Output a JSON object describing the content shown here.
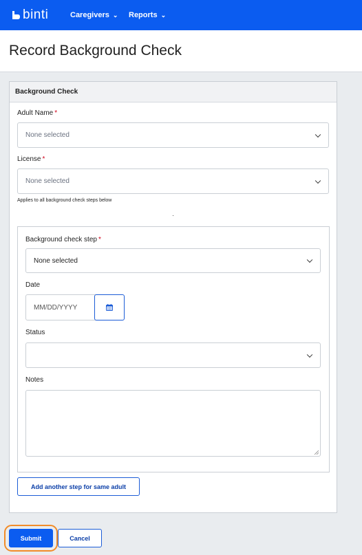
{
  "app": {
    "logo_text": "binti",
    "nav": [
      {
        "label": "Caregivers",
        "icon": "chevron-down-icon"
      },
      {
        "label": "Reports",
        "icon": "chevron-down-icon"
      }
    ]
  },
  "page": {
    "title": "Record Background Check"
  },
  "card": {
    "header": "Background Check",
    "adult_name": {
      "label": "Adult Name",
      "required": "*",
      "value": "None selected"
    },
    "license": {
      "label": "License",
      "required": "*",
      "value": "None selected",
      "helper": "Applies to all background check steps below"
    },
    "step_group": {
      "step": {
        "label": "Background check step",
        "required": "*",
        "value": "None selected"
      },
      "date": {
        "label": "Date",
        "placeholder": "MM/DD/YYYY",
        "icon": "calendar-icon"
      },
      "status": {
        "label": "Status",
        "value": ""
      },
      "notes": {
        "label": "Notes",
        "value": ""
      }
    },
    "add_step_label": "Add another step for same adult"
  },
  "actions": {
    "submit_label": "Submit",
    "cancel_label": "Cancel"
  },
  "colors": {
    "brand": "#0b5cf0",
    "focus": "#f28c28",
    "required": "#d0021b"
  }
}
